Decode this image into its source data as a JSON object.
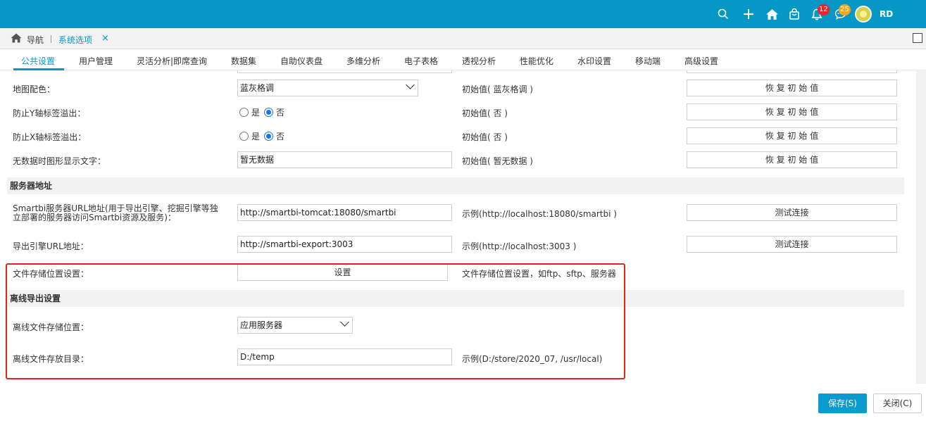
{
  "topbar": {
    "notifications_count": "12",
    "messages_count": "25",
    "user_initials": "RD",
    "accent": "#0598c7",
    "icons": [
      "search-icon",
      "plus-icon",
      "home-icon",
      "bag-icon",
      "bell-icon",
      "chat-icon",
      "avatar"
    ]
  },
  "breadcrumb": {
    "nav_label": "导航",
    "current_tab": "系统选项",
    "close_symbol": "×"
  },
  "menu": {
    "items": [
      "公共设置",
      "用户管理",
      "灵活分析|即席查询",
      "数据集",
      "自助仪表盘",
      "多维分析",
      "电子表格",
      "透视分析",
      "性能优化",
      "水印设置",
      "移动端",
      "高级设置"
    ],
    "active": "公共设置"
  },
  "rows": {
    "map_color": {
      "label": "地图配色：",
      "value": "蓝灰格调",
      "hint": "初始值( 蓝灰格调 )",
      "button": "恢 复 初 始 值"
    },
    "y_overflow": {
      "label": "防止Y轴标签溢出：",
      "yes": "是",
      "no": "否",
      "selected": "否",
      "hint": "初始值( 否 )",
      "button": "恢 复 初 始 值"
    },
    "x_overflow": {
      "label": "防止X轴标签溢出：",
      "yes": "是",
      "no": "否",
      "selected": "否",
      "hint": "初始值( 否 )",
      "button": "恢 复 初 始 值"
    },
    "no_data_text": {
      "label": "无数据时图形显示文字：",
      "value": "暂无数据",
      "hint": "初始值( 暂无数据 )",
      "button": "恢 复 初 始 值"
    }
  },
  "server_section": {
    "title": "服务器地址",
    "smartbi_url": {
      "label": "Smartbi服务器URL地址(用于导出引擎、挖掘引擎等独立部署的服务器访问Smartbi资源及服务)：",
      "value": "http://smartbi-tomcat:18080/smartbi",
      "hint": "示例(http://localhost:18080/smartbi )",
      "button": "测试连接"
    },
    "export_url": {
      "label": "导出引擎URL地址：",
      "value": "http://smartbi-export:3003",
      "hint": "示例(http://localhost:3003 )",
      "button": "测试连接"
    },
    "file_storage": {
      "label": "文件存储位置设置：",
      "button": "设置",
      "hint": "文件存储位置设置，如ftp、sftp、服务器"
    }
  },
  "offline_section": {
    "title": "离线导出设置",
    "storage_location": {
      "label": "离线文件存储位置：",
      "value": "应用服务器"
    },
    "storage_dir": {
      "label": "离线文件存放目录：",
      "value": "D:/temp",
      "hint": "示例(D:/store/2020_07, /usr/local)"
    }
  },
  "footer": {
    "save": "保存(S)",
    "close": "关闭(C)"
  }
}
